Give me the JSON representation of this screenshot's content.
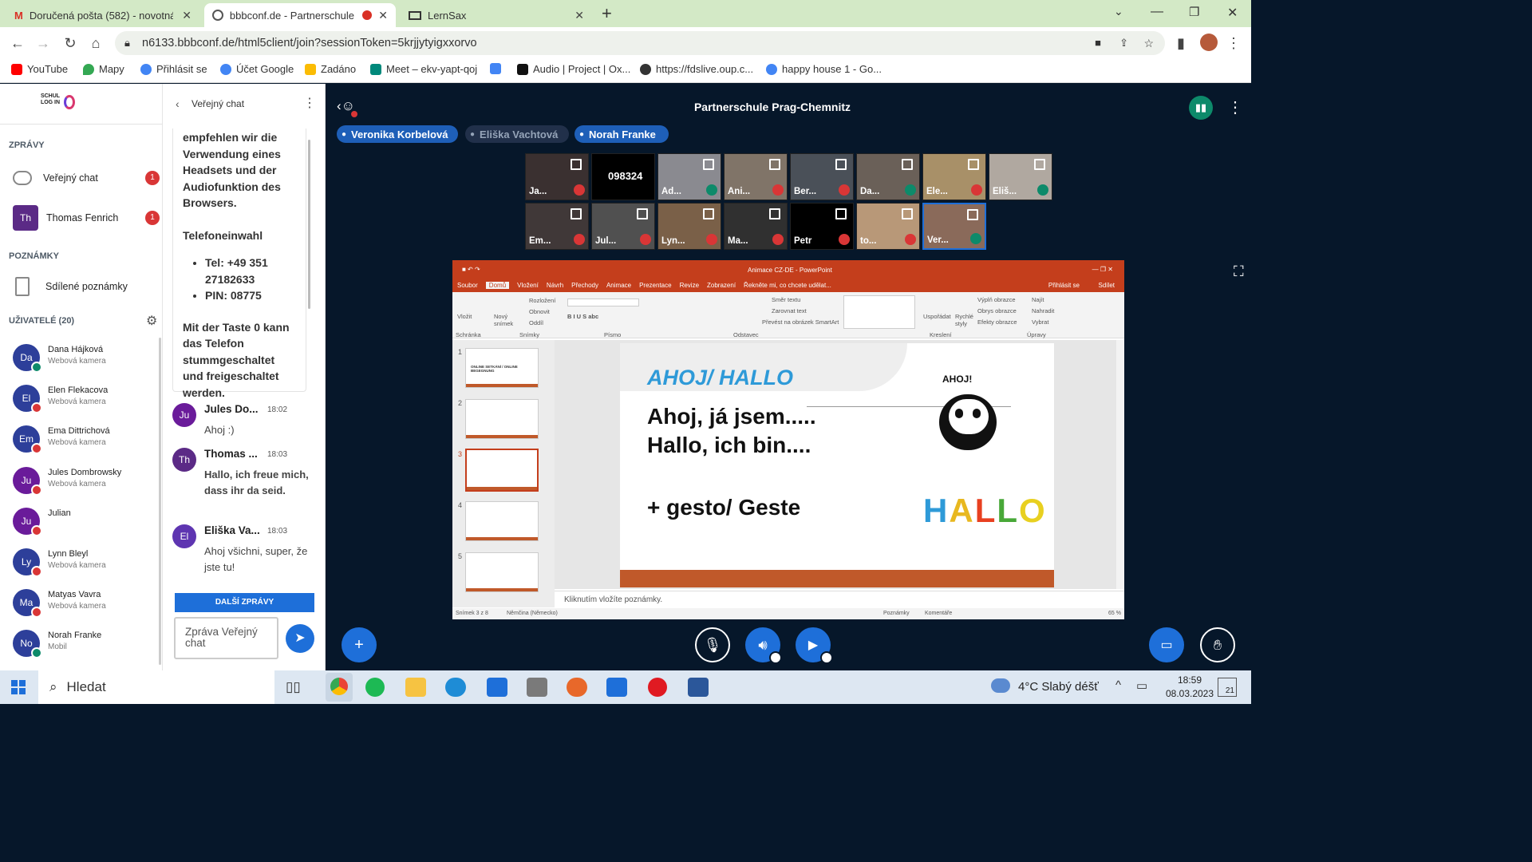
{
  "browser": {
    "tabs": [
      {
        "label": "Doručená pošta (582) - novotná.j",
        "icon": "gmail-icon",
        "active": false
      },
      {
        "label": "bbbconf.de - Partnerschule P",
        "icon": "bbb-icon",
        "active": true
      },
      {
        "label": "LernSax",
        "icon": "laptop-icon",
        "active": false
      }
    ],
    "new_tab": "+",
    "url": "n6133.bbbconf.de/html5client/join?sessionToken=5krjjytyigxxorvo",
    "bookmarks": [
      {
        "label": "YouTube",
        "color": "#ff0000"
      },
      {
        "label": "Mapy",
        "color": "#34a853"
      },
      {
        "label": "Přihlásit se",
        "color": "#4285f4"
      },
      {
        "label": "Účet Google",
        "color": "#4285f4"
      },
      {
        "label": "Zadáno",
        "color": "#fbbc04"
      },
      {
        "label": "Meet – ekv-yapt-qoj",
        "color": "#00897b"
      },
      {
        "label": "",
        "color": "#4285f4"
      },
      {
        "label": "Audio | Project | Ox...",
        "color": "#111111"
      },
      {
        "label": "https://fdslive.oup.c...",
        "color": "#333333"
      },
      {
        "label": "happy house 1 - Go...",
        "color": "#4285f4"
      }
    ]
  },
  "sidebar": {
    "logo": "SCHUL LOG IN",
    "messages_title": "ZPRÁVY",
    "public_chat": {
      "label": "Veřejný chat",
      "badge": "1"
    },
    "private_chat": {
      "initials": "Th",
      "label": "Thomas Fenrich",
      "badge": "1"
    },
    "notes_title": "POZNÁMKY",
    "shared_notes": "Sdílené poznámky",
    "users_title": "UŽIVATELÉ (20)",
    "users": [
      {
        "initials": "Da",
        "name": "Dana Hájková",
        "sub": "Webová kamera",
        "color": "#2d3f9a",
        "mic": "on"
      },
      {
        "initials": "El",
        "name": "Elen Flekacova",
        "sub": "Webová kamera",
        "color": "#2d3f9a",
        "mic": "off"
      },
      {
        "initials": "Em",
        "name": "Ema Dittrichová",
        "sub": "Webová kamera",
        "color": "#2d3f9a",
        "mic": "off"
      },
      {
        "initials": "Ju",
        "name": "Jules Dombrowsky",
        "sub": "Webová kamera",
        "color": "#6a1b9a",
        "mic": "off"
      },
      {
        "initials": "Ju",
        "name": "Julian",
        "sub": "",
        "color": "#6a1b9a",
        "mic": "off"
      },
      {
        "initials": "Ly",
        "name": "Lynn Bleyl",
        "sub": "Webová kamera",
        "color": "#2d3f9a",
        "mic": "off"
      },
      {
        "initials": "Ma",
        "name": "Matyas Vavra",
        "sub": "Webová kamera",
        "color": "#2d3f9a",
        "mic": "off"
      },
      {
        "initials": "No",
        "name": "Norah Franke",
        "sub": "Mobil",
        "color": "#2d3f9a",
        "mic": "on"
      }
    ]
  },
  "chat": {
    "title": "Veřejný chat",
    "welcome_text": "empfehlen wir die Verwendung eines Headsets und der Audiofunktion des Browsers.",
    "phone_title": "Telefoneinwahl",
    "phone_tel": "Tel: +49 351 27182633",
    "phone_pin": "PIN: 08775",
    "mute_text": "Mit der Taste 0 kann das Telefon stummgeschaltet und freigeschaltet werden.",
    "messages": [
      {
        "initials": "Ju",
        "name": "Jules Do...",
        "time": "18:02",
        "text": "Ahoj :)",
        "color": "#6a1b9a"
      },
      {
        "initials": "Th",
        "name": "Thomas ...",
        "time": "18:03",
        "text": "Hallo, ich freue mich, dass ihr da seid.",
        "color": "#5b2a86"
      },
      {
        "initials": "El",
        "name": "Eliška Va...",
        "time": "18:03",
        "text": "Ahoj všichni, super, že jste tu!",
        "color": "#5e35b1"
      }
    ],
    "more_button": "DALŠÍ ZPRÁVY",
    "input_placeholder": "Zpráva Veřejný chat"
  },
  "main": {
    "title": "Partnerschule Prag-Chemnitz",
    "talkers": [
      {
        "name": "Veronika Korbelová",
        "active": true
      },
      {
        "name": "Eliška Vachtová",
        "active": false
      },
      {
        "name": "Norah Franke",
        "active": true
      }
    ],
    "videos_row1": [
      {
        "label": "Ja...",
        "mic": "off",
        "bg": "#3a3030"
      },
      {
        "label": "098324",
        "mic": "none",
        "bg": "#000000"
      },
      {
        "label": "Ad...",
        "mic": "on",
        "bg": "#8a8a90"
      },
      {
        "label": "Ani...",
        "mic": "off",
        "bg": "#807468"
      },
      {
        "label": "Ber...",
        "mic": "off",
        "bg": "#4a5058"
      },
      {
        "label": "Da...",
        "mic": "on",
        "bg": "#6a6058"
      },
      {
        "label": "Ele...",
        "mic": "off",
        "bg": "#a89068"
      },
      {
        "label": "Eliš...",
        "mic": "on",
        "bg": "#b0a8a0"
      }
    ],
    "videos_row2": [
      {
        "label": "Em...",
        "mic": "off",
        "bg": "#403838"
      },
      {
        "label": "Jul...",
        "mic": "off",
        "bg": "#505050"
      },
      {
        "label": "Lyn...",
        "mic": "off",
        "bg": "#7a6048"
      },
      {
        "label": "Ma...",
        "mic": "off",
        "bg": "#303030"
      },
      {
        "label": "Petr",
        "mic": "off",
        "bg": "#000000"
      },
      {
        "label": "to...",
        "mic": "off",
        "bg": "#b89878"
      },
      {
        "label": "Ver...",
        "mic": "on",
        "bg": "#8a6a5a"
      }
    ]
  },
  "ppt": {
    "window_title": "Animace CZ-DE - PowerPoint",
    "tabs": [
      "Soubor",
      "Domů",
      "Vložení",
      "Návrh",
      "Přechody",
      "Animace",
      "Prezentace",
      "Revize",
      "Zobrazení",
      "Řekněte mi, co chcete udělat..."
    ],
    "signin": "Přihlásit se",
    "share": "Sdílet",
    "ribbon_groups": [
      "Schránka",
      "Snímky",
      "Písmo",
      "Odstavec",
      "Kreslení",
      "Úpravy"
    ],
    "ribbon": {
      "paste": "Vložit",
      "new_slide": "Nový snímek",
      "layout": "Rozložení",
      "reset": "Obnovit",
      "section": "Oddíl",
      "text_direction": "Směr textu",
      "align_text": "Zarovnat text",
      "smartart": "Převést na obrázek SmartArt",
      "arrange": "Uspořádat",
      "quick_styles": "Rychlé styly",
      "shape_fill": "Výplň obrazce",
      "shape_outline": "Obrys obrazce",
      "shape_effects": "Efekty obrazce",
      "find": "Najít",
      "replace": "Nahradit",
      "select": "Vybrat"
    },
    "slide_numbers": [
      "1",
      "2",
      "3",
      "4",
      "5"
    ],
    "thumb1": "ONLINE SETKÁNÍ / ONLINE BEGEGNUNG",
    "slide": {
      "heading": "AHOJ/ HALLO",
      "line1": "Ahoj, já jsem.....",
      "line2": "Hallo, ich bin....",
      "line3": "+ gesto/ Geste",
      "panda_text": "AHOJ!",
      "hallo_letters": [
        "H",
        "A",
        "L",
        "L",
        "O"
      ],
      "hallo_colors": [
        "#2e9ad8",
        "#e8b820",
        "#e84020",
        "#48a838",
        "#e8d020"
      ]
    },
    "notes_placeholder": "Kliknutím vložíte poznámky.",
    "status_slide": "Snímek 3 z 8",
    "status_lang": "Němčina (Německo)",
    "status_notes": "Poznámky",
    "status_comments": "Komentáře",
    "zoom": "65 %"
  },
  "taskbar": {
    "search": "Hledat",
    "weather": "4°C  Slabý déšť",
    "time": "18:59",
    "date": "08.03.2023",
    "notif": "21"
  }
}
